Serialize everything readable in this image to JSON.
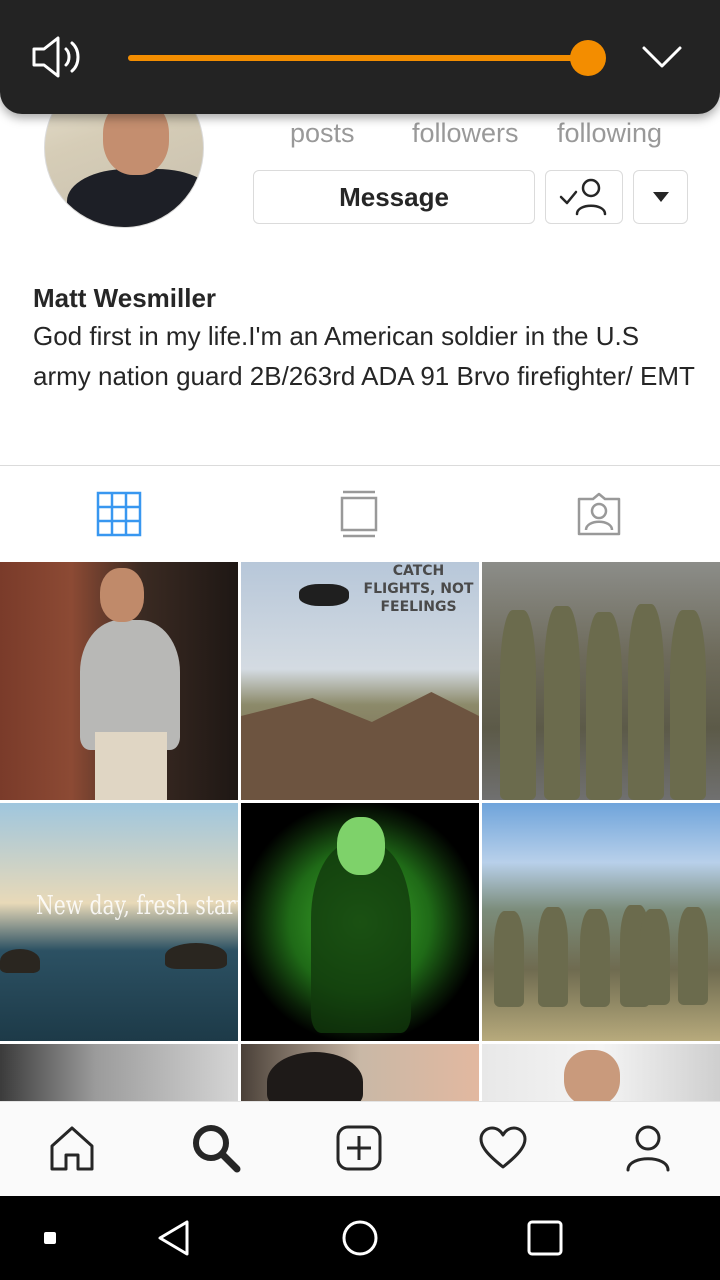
{
  "profile": {
    "stats": {
      "posts_label": "posts",
      "followers_label": "followers",
      "following_label": "following"
    },
    "buttons": {
      "message_label": "Message",
      "following_icon": "person-check-icon",
      "more_icon": "caret-down-icon"
    },
    "bio": {
      "name": "Matt Wesmiller",
      "text": "God first in my life.I'm an American soldier in the U.S army nation guard 2B/263rd ADA 91 Brvo firefighter/ EMT"
    }
  },
  "tabs": [
    {
      "icon": "grid-icon",
      "active": true
    },
    {
      "icon": "feed-icon",
      "active": false
    },
    {
      "icon": "tagged-icon",
      "active": false
    }
  ],
  "grid": {
    "posts": [
      {
        "overlay_text": ""
      },
      {
        "overlay_text": "CATCH FLIGHTS, NOT FEELINGS"
      },
      {
        "overlay_text": ""
      },
      {
        "overlay_text": "New day, fresh start"
      },
      {
        "overlay_text": ""
      },
      {
        "overlay_text": ""
      },
      {
        "overlay_text": ""
      },
      {
        "overlay_text": ""
      },
      {
        "overlay_text": ""
      }
    ]
  },
  "bottom_nav": [
    {
      "icon": "home-icon",
      "active": false
    },
    {
      "icon": "search-icon",
      "active": true
    },
    {
      "icon": "add-post-icon",
      "active": false
    },
    {
      "icon": "heart-icon",
      "active": false
    },
    {
      "icon": "profile-icon",
      "active": false
    }
  ],
  "volume": {
    "level": 1.0,
    "icon": "speaker-icon",
    "expand_icon": "chevron-down-icon"
  },
  "colors": {
    "accent_blue": "#3897f0",
    "volume_orange": "#f38d00",
    "text": "#262626",
    "muted": "#999999"
  }
}
